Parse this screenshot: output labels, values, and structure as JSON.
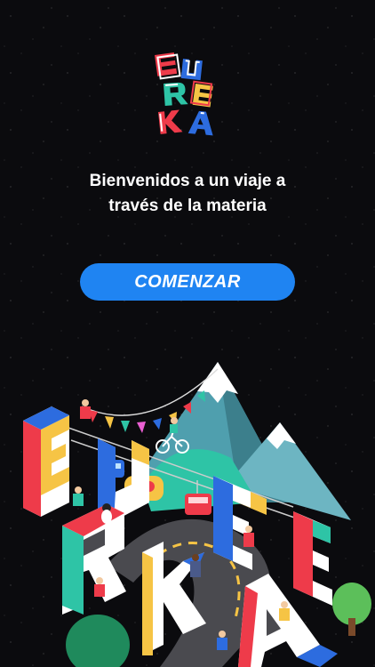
{
  "brand": {
    "logo_letters": [
      "E",
      "U",
      "R",
      "E",
      "K",
      "A"
    ],
    "colors": {
      "red": "#ee3b4a",
      "blue": "#2d6cdf",
      "yellow": "#f6c445",
      "teal": "#2ec4a6",
      "white": "#ffffff"
    }
  },
  "welcome": {
    "line1": "Bienvenidos a un viaje a",
    "line2": "través de la materia"
  },
  "cta": {
    "label": "COMENZAR",
    "color": "#1f84f2"
  },
  "illustration": {
    "letters": [
      "E",
      "U",
      "R",
      "E",
      "K",
      "A"
    ],
    "icons": [
      "mountain-icon",
      "bunting-flags-icon",
      "cable-car-icon",
      "cyclist-icon",
      "road-icon",
      "tree-icon"
    ]
  }
}
